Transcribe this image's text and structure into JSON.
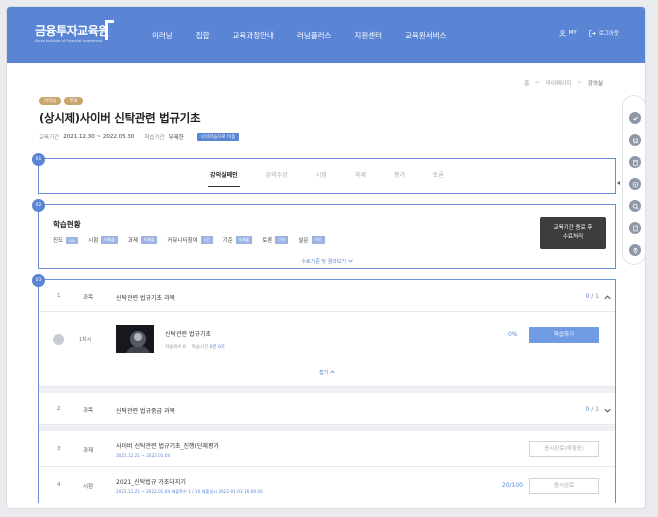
{
  "header": {
    "logo_title": "금융투자교육원",
    "logo_subtitle": "Korea Institute of Financial Investment",
    "nav": [
      "이러닝",
      "집합",
      "교육과정안내",
      "러닝플러스",
      "지원센터",
      "교육원서비스"
    ],
    "util": [
      "MY",
      "로그아웃"
    ]
  },
  "breadcrumb": [
    "홈",
    "마이페이지",
    "강의실"
  ],
  "course": {
    "badges": [
      "이러닝",
      "무료"
    ],
    "title": "(상시제)사이버 신탁관련 법규기초",
    "period_label": "교육기간",
    "period_value": "2021.12.30 ~ 2022.05.30",
    "status_label": "학습기간",
    "status_value": "무제한",
    "tag": "나의학습으로 이동"
  },
  "tabs": [
    "강의실메인",
    "강의수강",
    "시험",
    "과제",
    "평가",
    "토론"
  ],
  "progress": {
    "step": "02",
    "title": "학습현황",
    "items": [
      {
        "label": "진도",
        "value": "0%"
      },
      {
        "label": "시험",
        "value": "미제출"
      },
      {
        "label": "과제",
        "value": "미제출"
      },
      {
        "label": "커뮤니티참여",
        "value": "0건"
      },
      {
        "label": "기준",
        "value": "미제출"
      },
      {
        "label": "토론",
        "value": "기타"
      },
      {
        "label": "설문",
        "value": "기타"
      }
    ],
    "button_line1": "교육기간 종료 후",
    "button_line2": "수료처리",
    "more": "수료기준 및 결과보기"
  },
  "steps": {
    "tabs": "01",
    "list": "03"
  },
  "course_list": {
    "rows": [
      {
        "no": "1",
        "type": "과목",
        "name": "신탁관련 법규기초 과목",
        "score": "0",
        "total": "1",
        "chevron": "up"
      },
      {
        "no": "2",
        "type": "과목",
        "name": "신탁관련 법규중급 과목",
        "score": "0",
        "total": "1",
        "chevron": "down"
      },
      {
        "no": "3",
        "type": "과제",
        "name": "사이버 신탁관련 법규기초_진행(단체평가",
        "sub": "2021.12.21 ~ 2022.01.04",
        "button": "응시완료(채점중)"
      },
      {
        "no": "4",
        "type": "시험",
        "name": "2021_신탁법규 기초다지기",
        "sub": "2021.12.21 ~ 2022.01.04  제출횟수 1 / 10  제출일시 2022-01-03 16:00:56",
        "score_text": "20/100",
        "button": "응시완료"
      }
    ],
    "lesson": {
      "times": "1차시",
      "name": "신탁관련 법규기초",
      "meta_label1": "학습회수",
      "meta_value1": "0",
      "meta_label2": "학습시간",
      "meta_value2": "0분 0초",
      "percent": "0%",
      "button": "학습하기"
    },
    "fold": "접기"
  },
  "quick_icons": [
    "check-icon",
    "cart-icon",
    "trash-icon",
    "help-icon",
    "search-icon",
    "book-icon",
    "pin-icon"
  ],
  "colors": {
    "brand": "#5a84d4",
    "accent": "#6f9be3",
    "badge": "#c9a46c",
    "dark_button": "#3d3d3d"
  }
}
